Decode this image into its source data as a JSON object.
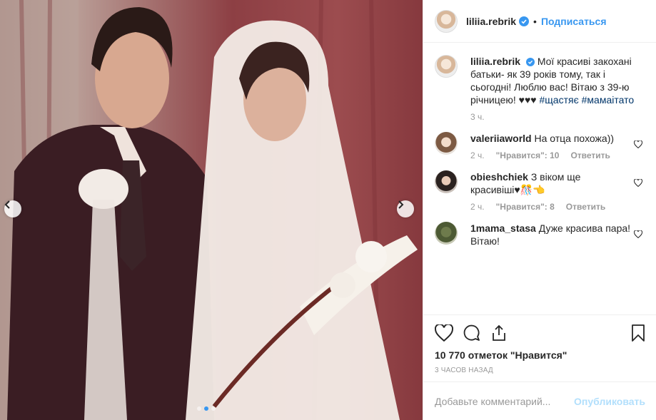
{
  "post": {
    "username": "liliia.rebrik",
    "follow_label": "Подписаться",
    "separator": "•",
    "caption_user": "liliia.rebrik",
    "caption_text": "Мої красиві закохані батьки- як 39 років тому, так і сьогодні! Люблю вас! Вітаю з 39-ю річницею! ♥♥♥",
    "tag_1": "#щастяє",
    "tag_2": "#мамаітато",
    "caption_time": "3 ч.",
    "likes": "10 770 отметок \"Нравится\"",
    "timestamp": "3 ЧАСОВ НАЗАД",
    "comment_placeholder": "Добавьте комментарий...",
    "publish_label": "Опубликовать"
  },
  "comments": [
    {
      "user": "valeriiaworld",
      "text": "На отца похожа))",
      "time": "2 ч.",
      "likes": "\"Нравится\": 10",
      "reply": "Ответить"
    },
    {
      "user": "obieshchiek",
      "text": "З віком ще красивіші♥🎊👈",
      "time": "2 ч.",
      "likes": "\"Нравится\": 8",
      "reply": "Ответить"
    },
    {
      "user": "1mama_stasa",
      "text": "Дуже красива пара! Вітаю!"
    }
  ],
  "carousel": {
    "slides": 3,
    "active": 1
  },
  "colors": {
    "link": "#3897f0",
    "tag": "#003569",
    "muted": "#999999",
    "publish_disabled": "#b2dffc"
  },
  "icons": [
    "heart-icon",
    "comment-icon",
    "share-icon",
    "bookmark-icon",
    "verified-badge-icon",
    "chevron-left-icon",
    "chevron-right-icon"
  ]
}
